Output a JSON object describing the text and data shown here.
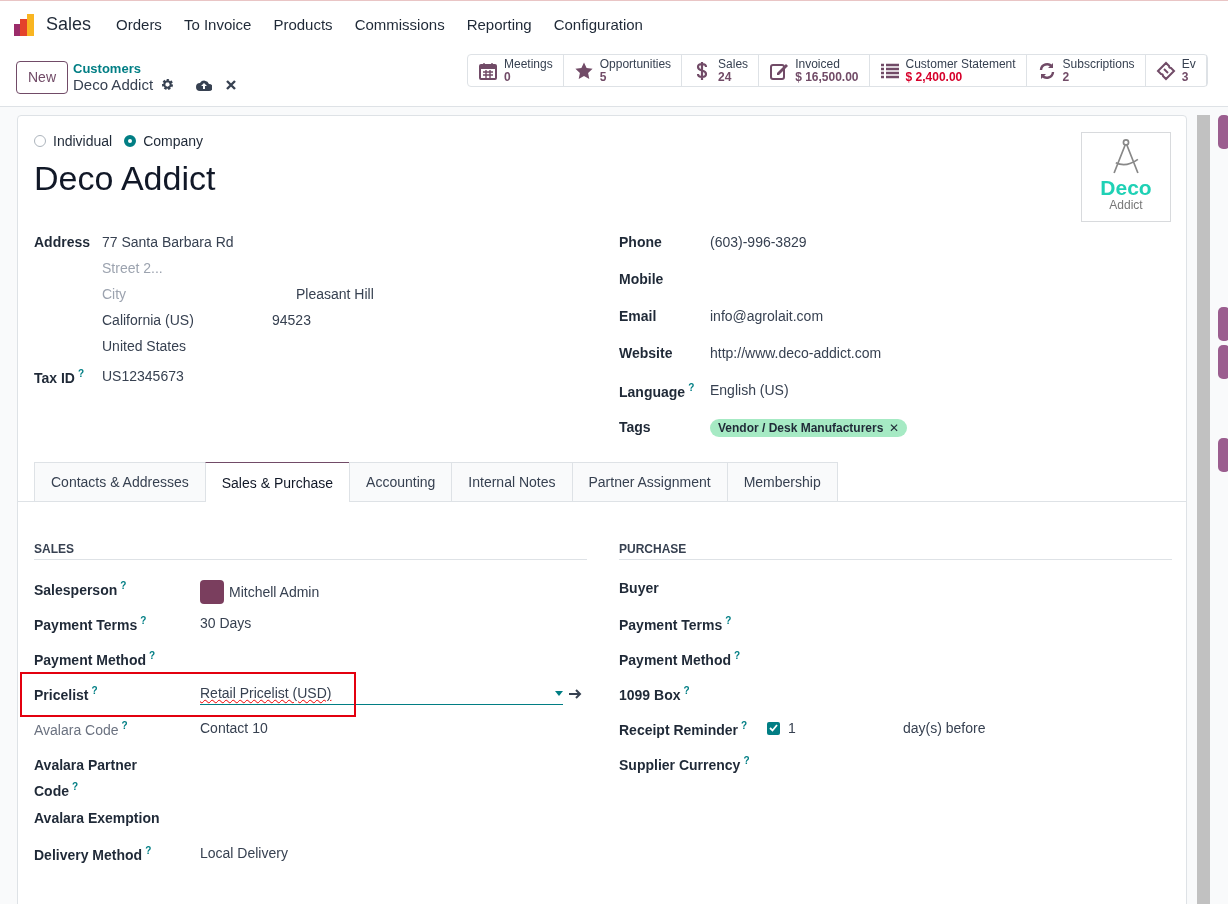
{
  "nav": {
    "app": "Sales",
    "menu": [
      "Orders",
      "To Invoice",
      "Products",
      "Commissions",
      "Reporting",
      "Configuration"
    ]
  },
  "control": {
    "new_button": "New",
    "breadcrumb": "Customers",
    "record": "Deco Addict"
  },
  "stats": [
    {
      "label": "Meetings",
      "value": "0",
      "alert": false
    },
    {
      "label": "Opportunities",
      "value": "5",
      "alert": false
    },
    {
      "label": "Sales",
      "value": "24",
      "alert": false
    },
    {
      "label": "Invoiced",
      "value": "$ 16,500.00",
      "alert": false
    },
    {
      "label": "Customer Statement",
      "value": "$ 2,400.00",
      "alert": true
    },
    {
      "label": "Subscriptions",
      "value": "2",
      "alert": false
    },
    {
      "label": "Ev",
      "value": "3",
      "alert": false
    }
  ],
  "company_type": [
    {
      "label": "Individual",
      "selected": false
    },
    {
      "label": "Company",
      "selected": true
    }
  ],
  "name": "Deco Addict",
  "logo": {
    "title": "Deco",
    "subtitle": "Addict"
  },
  "address": {
    "label": "Address",
    "street": "77 Santa Barbara Rd",
    "street2_placeholder": "Street 2...",
    "city_placeholder": "City",
    "city_value": "Pleasant Hill",
    "state": "California (US)",
    "zip": "94523",
    "country": "United States"
  },
  "tax_id": {
    "label": "Tax ID",
    "help": "?",
    "value": "US12345673"
  },
  "contact_fields": [
    {
      "label": "Phone",
      "value": "(603)-996-3829"
    },
    {
      "label": "Mobile"
    },
    {
      "label": "Email",
      "value": "info@agrolait.com"
    },
    {
      "label": "Website",
      "value": "http://www.deco-addict.com"
    },
    {
      "label": "Language",
      "help": "?",
      "value": "English (US)"
    }
  ],
  "tags": {
    "label": "Tags",
    "items": [
      {
        "text": "Vendor / Desk Manufacturers",
        "remove": "✕",
        "color": "#a6eac4"
      }
    ]
  },
  "tabs": [
    {
      "label": "Contacts & Addresses",
      "selected": false
    },
    {
      "label": "Sales & Purchase",
      "selected": true
    },
    {
      "label": "Accounting",
      "selected": false
    },
    {
      "label": "Internal Notes",
      "selected": false
    },
    {
      "label": "Partner Assignment",
      "selected": false
    },
    {
      "label": "Membership",
      "selected": false
    }
  ],
  "sales": {
    "title": "SALES",
    "fields": [
      {
        "kind": "avatar",
        "label": "Salesperson",
        "help": "?",
        "value": "Mitchell Admin",
        "disabled": false,
        "highlighted": false
      },
      {
        "kind": "text",
        "label": "Payment Terms",
        "help": "?",
        "value": "30 Days",
        "disabled": false,
        "highlighted": false
      },
      {
        "kind": "text",
        "label": "Payment Method",
        "help": "?",
        "disabled": false,
        "highlighted": false
      },
      {
        "kind": "select",
        "label": "Pricelist",
        "help": "?",
        "value": "Retail Pricelist (USD)",
        "disabled": false,
        "highlighted": true
      },
      {
        "kind": "text",
        "label": "Avalara Code",
        "help": "?",
        "value": "Contact 10",
        "disabled": true,
        "highlighted": false
      },
      {
        "kind": "text",
        "label": "Avalara Partner Code",
        "help": "?",
        "disabled": false,
        "highlighted": false
      },
      {
        "kind": "text",
        "label": "Avalara Exemption",
        "disabled": false,
        "highlighted": false
      },
      {
        "kind": "text",
        "label": "Delivery Method",
        "help": "?",
        "value": "Local Delivery",
        "disabled": false,
        "highlighted": false
      }
    ]
  },
  "purchase": {
    "title": "PURCHASE",
    "fields": [
      {
        "kind": "text",
        "label": "Buyer"
      },
      {
        "kind": "text",
        "label": "Payment Terms",
        "help": "?"
      },
      {
        "kind": "text",
        "label": "Payment Method",
        "help": "?"
      },
      {
        "kind": "text",
        "label": "1099 Box",
        "help": "?"
      },
      {
        "kind": "reminder",
        "label": "Receipt Reminder",
        "help": "?",
        "checked": true,
        "value": "1",
        "unit": "day(s) before"
      },
      {
        "kind": "text",
        "label": "Supplier Currency",
        "help": "?"
      }
    ]
  }
}
